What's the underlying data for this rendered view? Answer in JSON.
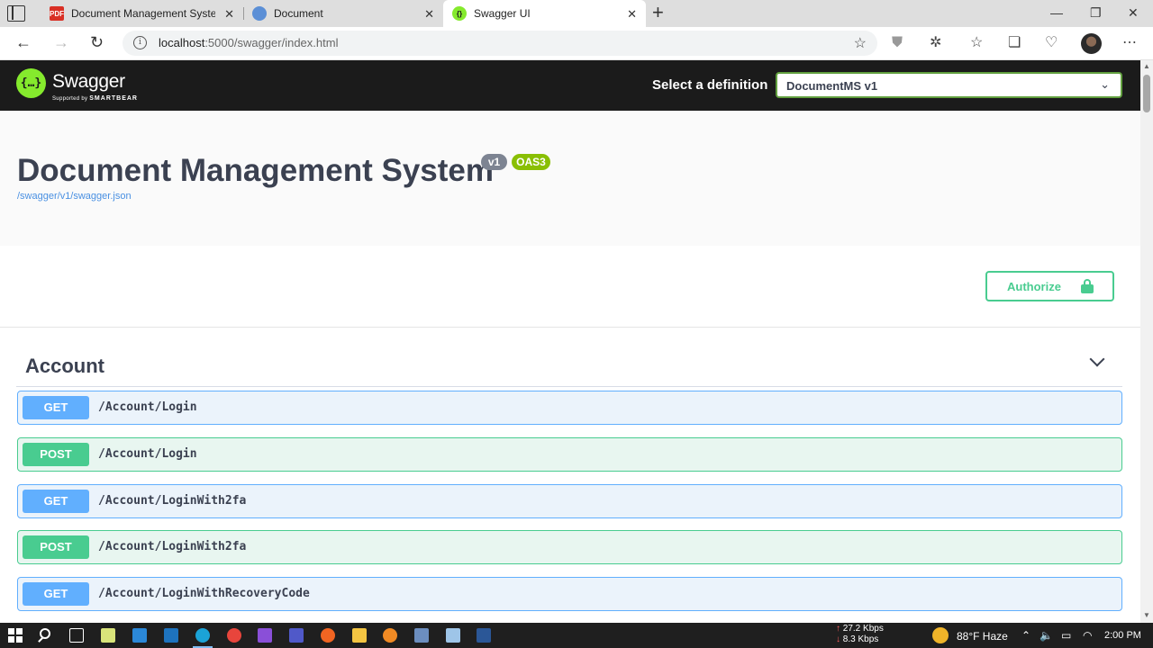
{
  "browser": {
    "tabs": [
      {
        "title": "Document Management System",
        "favicon": "pdf-icon",
        "active": false
      },
      {
        "title": "Document",
        "favicon": "cloud-icon",
        "active": false
      },
      {
        "title": "Swagger UI",
        "favicon": "swagger-icon",
        "active": true
      }
    ],
    "url_host": "localhost",
    "url_path": ":5000/swagger/index.html"
  },
  "swagger": {
    "brand": "Swagger",
    "brand_sub_prefix": "Supported by",
    "brand_sub": "SMARTBEAR",
    "definition_label": "Select a definition",
    "definition_value": "DocumentMS v1"
  },
  "info": {
    "title": "Document Management System",
    "version_badge": "v1",
    "oas_badge": "OAS3",
    "spec_url": "/swagger/v1/swagger.json"
  },
  "auth": {
    "button_label": "Authorize"
  },
  "tag": {
    "name": "Account",
    "operations": [
      {
        "method": "GET",
        "path": "/Account/Login"
      },
      {
        "method": "POST",
        "path": "/Account/Login"
      },
      {
        "method": "GET",
        "path": "/Account/LoginWith2fa"
      },
      {
        "method": "POST",
        "path": "/Account/LoginWith2fa"
      },
      {
        "method": "GET",
        "path": "/Account/LoginWithRecoveryCode"
      }
    ]
  },
  "taskbar": {
    "net_up": "27.2 Kbps",
    "net_down": "8.3 Kbps",
    "weather": "88°F  Haze",
    "time": "2:00 PM"
  },
  "colors": {
    "get": "#61affe",
    "post": "#49cc90",
    "topbar": "#1b1b1b",
    "title": "#3b4151"
  }
}
